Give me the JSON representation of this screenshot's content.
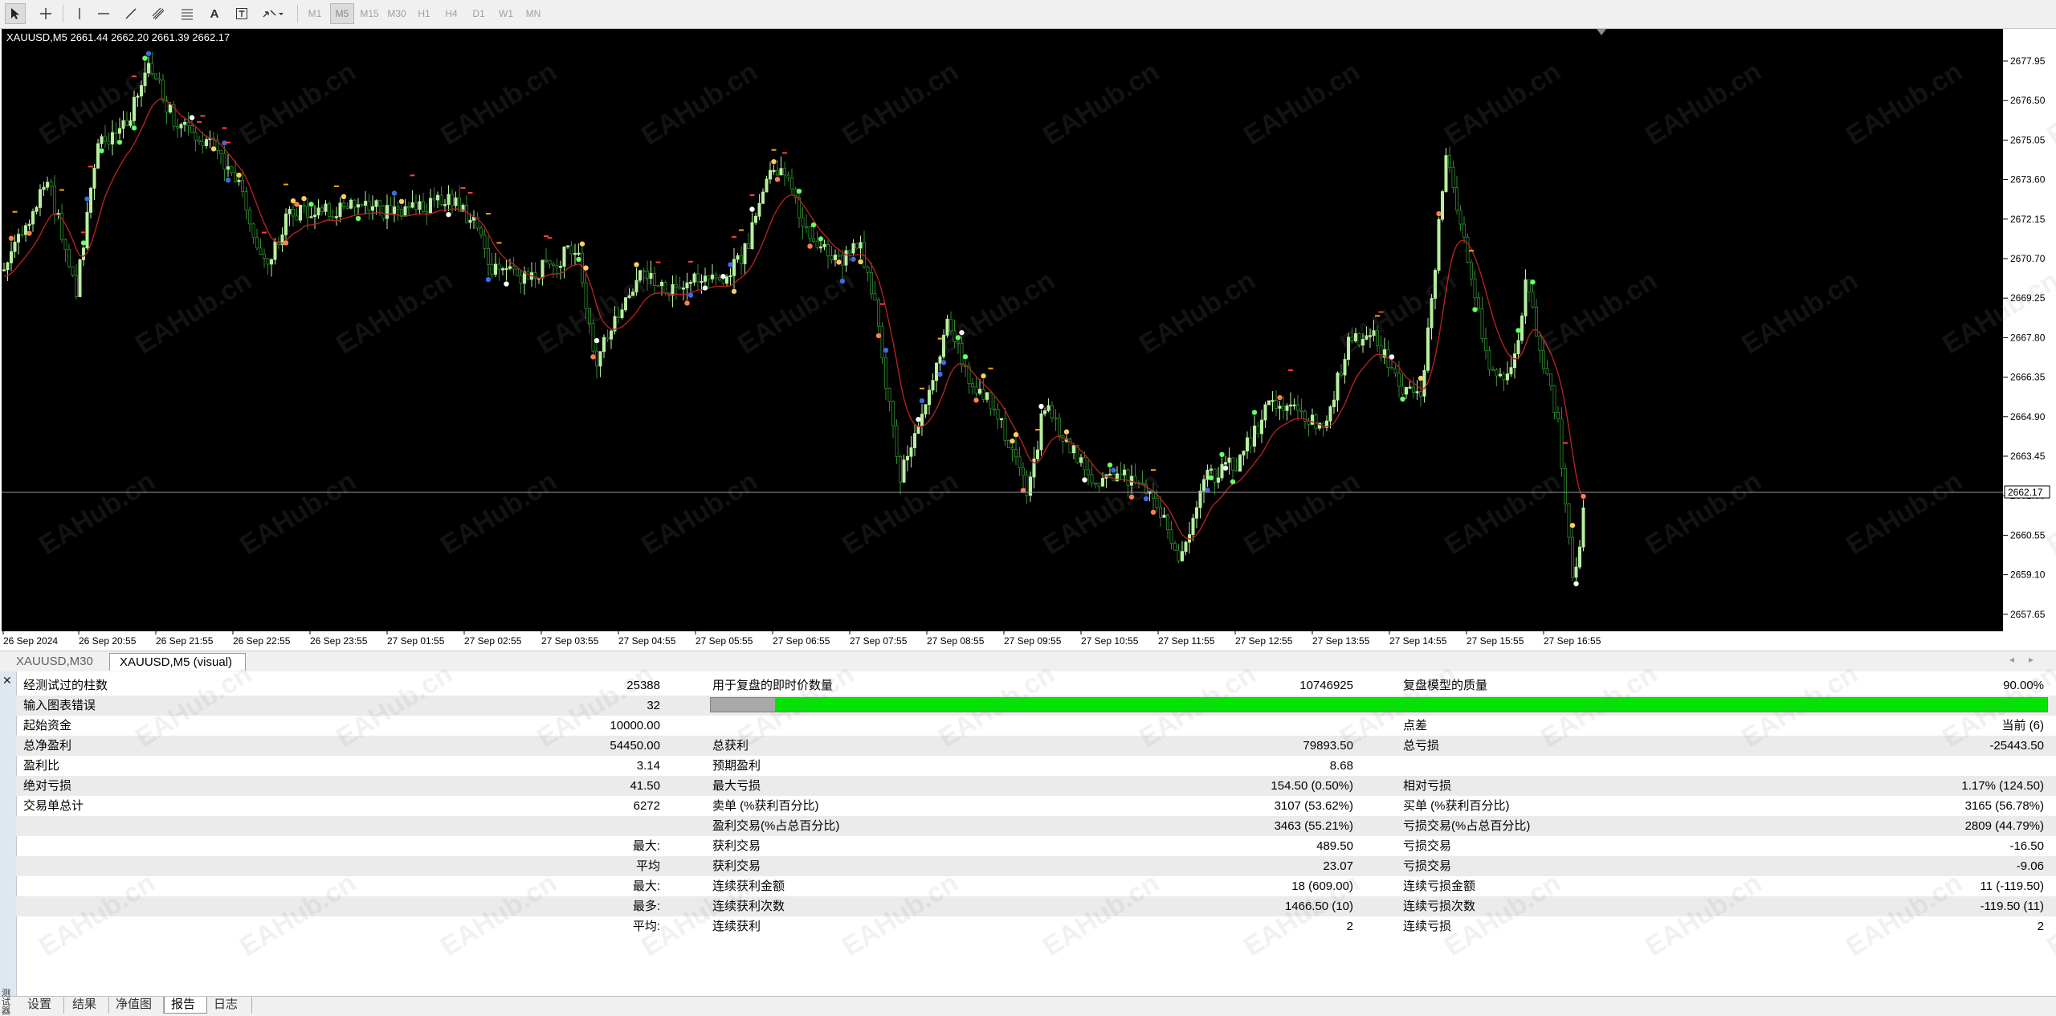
{
  "toolbar": {
    "timeframes": [
      "M1",
      "M5",
      "M15",
      "M30",
      "H1",
      "H4",
      "D1",
      "W1",
      "MN"
    ],
    "active_timeframe": "M5",
    "text_tool": "A"
  },
  "chart": {
    "header": "XAUUSD,M5  2661.44 2662.20 2661.39 2662.17",
    "price_labels": [
      "2677.95",
      "2676.50",
      "2675.05",
      "2673.60",
      "2672.15",
      "2670.70",
      "2669.25",
      "2667.80",
      "2666.35",
      "2664.90",
      "2663.45",
      "2662.00",
      "2660.55",
      "2659.10",
      "2657.65"
    ],
    "current_price": "2662.17",
    "time_labels": [
      "26 Sep 2024",
      "26 Sep 20:55",
      "26 Sep 21:55",
      "26 Sep 22:55",
      "26 Sep 23:55",
      "27 Sep 01:55",
      "27 Sep 02:55",
      "27 Sep 03:55",
      "27 Sep 04:55",
      "27 Sep 05:55",
      "27 Sep 06:55",
      "27 Sep 07:55",
      "27 Sep 08:55",
      "27 Sep 09:55",
      "27 Sep 10:55",
      "27 Sep 11:55",
      "27 Sep 12:55",
      "27 Sep 13:55",
      "27 Sep 14:55",
      "27 Sep 15:55",
      "27 Sep 16:55"
    ],
    "colors": {
      "background": "#000000",
      "bull": "#b8f0a0",
      "bear": "#2e8b2e",
      "ma": "#b22222",
      "grid": "#ffffff"
    },
    "watermark": "EAHub.cn"
  },
  "chart_tabs": [
    {
      "label": "XAUUSD,M30",
      "active": false
    },
    {
      "label": "XAUUSD,M5 (visual)",
      "active": true
    }
  ],
  "report": {
    "rows": [
      {
        "c1l": "经测试过的柱数",
        "c1v": "25388",
        "c2l": "用于复盘的即时价数量",
        "c2v": "10746925",
        "c3l": "复盘模型的质量",
        "c3v": "90.00%"
      },
      {
        "c1l": "输入图表错误",
        "c1v": "32",
        "c2l": "",
        "c2v": "",
        "c3l": "",
        "c3v": ""
      },
      {
        "c1l": "起始资金",
        "c1v": "10000.00",
        "c2l": "",
        "c2v": "",
        "c3l": "点差",
        "c3v": "当前 (6)"
      },
      {
        "c1l": "总净盈利",
        "c1v": "54450.00",
        "c2l": "总获利",
        "c2v": "79893.50",
        "c3l": "总亏损",
        "c3v": "-25443.50"
      },
      {
        "c1l": "盈利比",
        "c1v": "3.14",
        "c2l": "预期盈利",
        "c2v": "8.68",
        "c3l": "",
        "c3v": ""
      },
      {
        "c1l": "绝对亏损",
        "c1v": "41.50",
        "c2l": "最大亏损",
        "c2v": "154.50 (0.50%)",
        "c3l": "相对亏损",
        "c3v": "1.17% (124.50)"
      },
      {
        "c1l": "交易单总计",
        "c1v": "6272",
        "c2l": "卖单 (%获利百分比)",
        "c2v": "3107 (53.62%)",
        "c3l": "买单 (%获利百分比)",
        "c3v": "3165 (56.78%)"
      },
      {
        "c1l": "",
        "c1v": "",
        "c2l": "盈利交易(%占总百分比)",
        "c2v": "3463 (55.21%)",
        "c3l": "亏损交易(%占总百分比)",
        "c3v": "2809 (44.79%)"
      },
      {
        "c1l": "",
        "c1v": "最大:",
        "c2l": "获利交易",
        "c2v": "489.50",
        "c3l": "亏损交易",
        "c3v": "-16.50"
      },
      {
        "c1l": "",
        "c1v": "平均",
        "c2l": "获利交易",
        "c2v": "23.07",
        "c3l": "亏损交易",
        "c3v": "-9.06"
      },
      {
        "c1l": "",
        "c1v": "最大:",
        "c2l": "连续获利金额",
        "c2v": "18 (609.00)",
        "c3l": "连续亏损金额",
        "c3v": "11 (-119.50)"
      },
      {
        "c1l": "",
        "c1v": "最多:",
        "c2l": "连续获利次数",
        "c2v": "1466.50 (10)",
        "c3l": "连续亏损次数",
        "c3v": "-119.50 (11)"
      },
      {
        "c1l": "",
        "c1v": "平均:",
        "c2l": "连续获利",
        "c2v": "2",
        "c3l": "连续亏损",
        "c3v": "2"
      }
    ],
    "progress": {
      "gray_fraction": 0.024,
      "green_fraction": 0.976
    }
  },
  "bottom_tabs": [
    {
      "label": "设置",
      "active": false
    },
    {
      "label": "结果",
      "active": false
    },
    {
      "label": "净值图",
      "active": false
    },
    {
      "label": "报告",
      "active": true
    },
    {
      "label": "日志",
      "active": false
    }
  ],
  "side_label": "测试器"
}
